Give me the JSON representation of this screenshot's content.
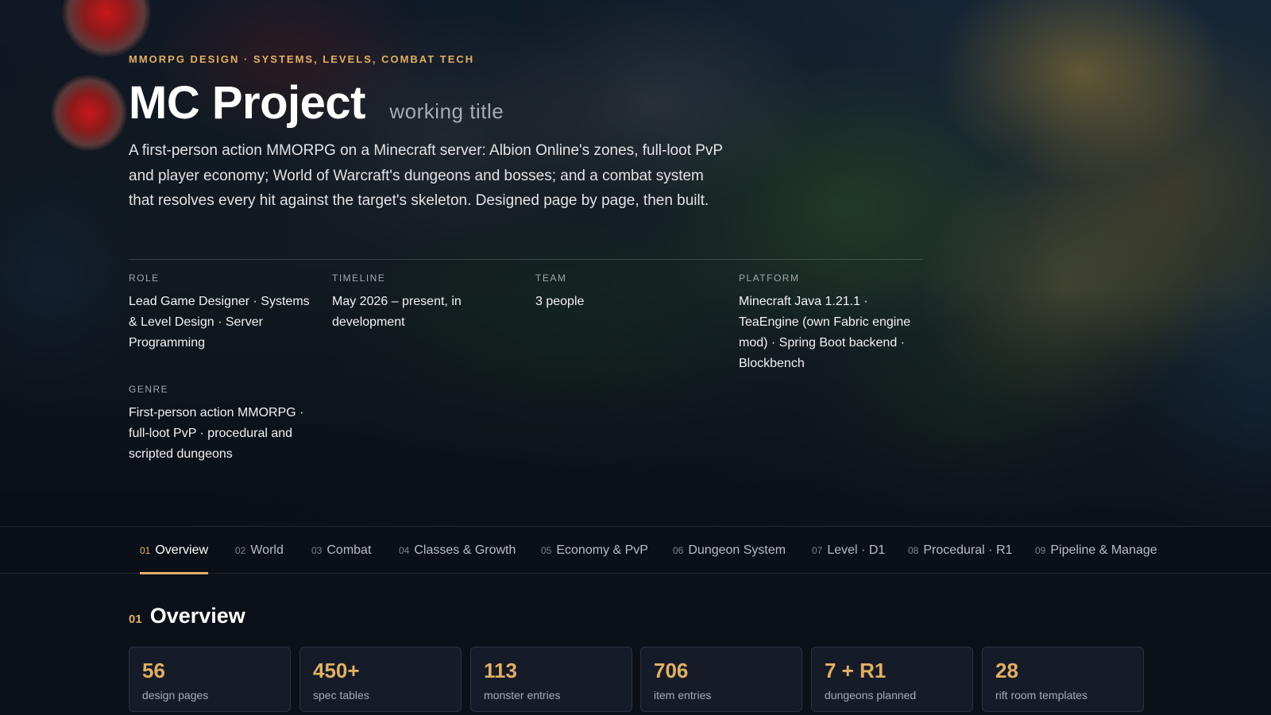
{
  "hero": {
    "eyebrow": "MMORPG DESIGN · SYSTEMS, LEVELS, COMBAT TECH",
    "title": "MC Project",
    "subtitle": "working title",
    "intro": "A first-person action MMORPG on a Minecraft server: Albion Online's zones, full-loot PvP and player economy; World of Warcraft's dungeons and bosses; and a combat system that resolves every hit against the target's skeleton. Designed page by page, then built.",
    "meta": {
      "role": {
        "label": "ROLE",
        "value": "Lead Game Designer · Systems & Level Design · Server Programming"
      },
      "timeline": {
        "label": "TIMELINE",
        "value": "May 2026 – present, in development"
      },
      "team": {
        "label": "TEAM",
        "value": "3 people"
      },
      "platform": {
        "label": "PLATFORM",
        "value": "Minecraft Java 1.21.1 · TeaEngine (own Fabric engine mod) · Spring Boot backend · Blockbench"
      },
      "genre": {
        "label": "GENRE",
        "value": "First-person action MMORPG · full-loot PvP · procedural and scripted dungeons"
      }
    }
  },
  "tabs": [
    {
      "num": "01",
      "label": "Overview"
    },
    {
      "num": "02",
      "label": "World"
    },
    {
      "num": "03",
      "label": "Combat"
    },
    {
      "num": "04",
      "label": "Classes & Growth"
    },
    {
      "num": "05",
      "label": "Economy & PvP"
    },
    {
      "num": "06",
      "label": "Dungeon System"
    },
    {
      "num": "07",
      "label": "Level · D1"
    },
    {
      "num": "08",
      "label": "Procedural · R1"
    },
    {
      "num": "09",
      "label": "Pipeline & Manage"
    }
  ],
  "overview": {
    "num": "01",
    "title": "Overview",
    "stats": [
      {
        "value": "56",
        "label": "design pages"
      },
      {
        "value": "450+",
        "label": "spec tables"
      },
      {
        "value": "113",
        "label": "monster entries"
      },
      {
        "value": "706",
        "label": "item entries"
      },
      {
        "value": "7 + R1",
        "label": "dungeons planned"
      },
      {
        "value": "28",
        "label": "rift room templates"
      }
    ]
  },
  "colors": {
    "accent": "#e2b062",
    "background": "#0c1119",
    "card": "#161c27"
  }
}
